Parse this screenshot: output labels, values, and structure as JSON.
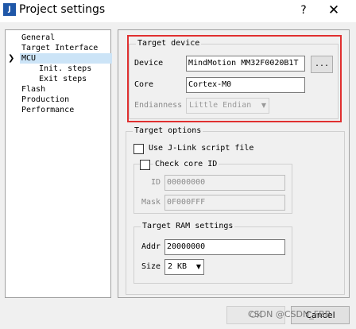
{
  "window": {
    "icon_text": "J\nLINK",
    "title": "Project settings",
    "help_label": "?",
    "close_label": "✕"
  },
  "tree": {
    "items": [
      {
        "label": "General"
      },
      {
        "label": "Target Interface"
      },
      {
        "label": "MCU",
        "selected": true,
        "expanded": true
      },
      {
        "label": "Init. steps"
      },
      {
        "label": "Exit steps"
      },
      {
        "label": "Flash"
      },
      {
        "label": "Production"
      },
      {
        "label": "Performance"
      }
    ],
    "expand_glyph": "❯"
  },
  "target_device": {
    "title": "Target device",
    "device_label": "Device",
    "device_value": "MindMotion MM32F0020B1T",
    "browse_label": "...",
    "core_label": "Core",
    "core_value": "Cortex-M0",
    "endianness_label": "Endianness",
    "endianness_value": "Little Endian",
    "endianness_enabled": false
  },
  "target_options": {
    "title": "Target options",
    "use_script_label": "Use J-Link script file",
    "use_script_checked": false,
    "check_core_label": "Check core ID",
    "check_core_checked": false,
    "id_label": "ID",
    "id_value": "00000000",
    "mask_label": "Mask",
    "mask_value": "0F000FFF"
  },
  "target_ram": {
    "title": "Target RAM settings",
    "addr_label": "Addr",
    "addr_value": "20000000",
    "size_label": "Size",
    "size_value": "2 KB"
  },
  "footer": {
    "ok_label": "OK",
    "cancel_label": "Cancel",
    "watermark": "CSDN @CSDN_FBB"
  },
  "colors": {
    "highlight_box": "#e03030",
    "selection": "#cce4f7"
  }
}
